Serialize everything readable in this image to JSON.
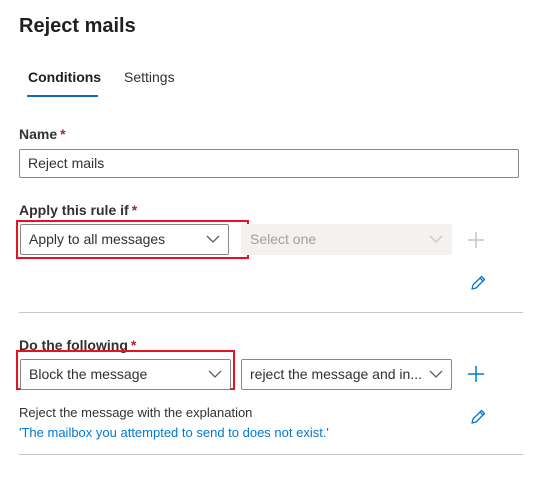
{
  "page": {
    "title": "Reject mails"
  },
  "tabs": [
    {
      "label": "Conditions",
      "active": true
    },
    {
      "label": "Settings",
      "active": false
    }
  ],
  "name_field": {
    "label": "Name",
    "required_mark": "*",
    "value": "Reject mails"
  },
  "apply_rule": {
    "label": "Apply this rule if",
    "required_mark": "*",
    "condition_value": "Apply to all messages",
    "secondary_placeholder": "Select one"
  },
  "do_following": {
    "label": "Do the following",
    "required_mark": "*",
    "action_value": "Block the message",
    "secondary_value": "reject the message and in...",
    "description": "Reject the message with the explanation",
    "explanation_link": "'The mailbox you attempted to send to does not exist.'"
  },
  "colors": {
    "accent": "#0f6cbd",
    "highlight": "#e81123",
    "link": "#0078d4"
  },
  "icons": {
    "add": "plus-icon",
    "edit": "pencil-icon",
    "dropdown": "chevron-down-icon"
  }
}
